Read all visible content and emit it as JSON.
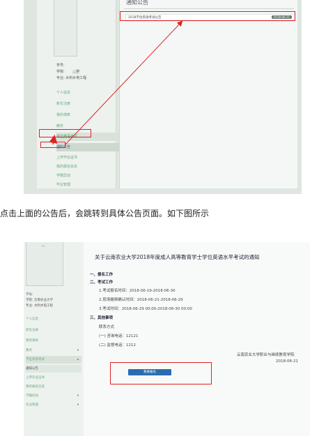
{
  "shot1": {
    "notice_title": "通知公告",
    "notice_item": {
      "title": "2018学位英语考试公告",
      "date": "2018-06-21"
    },
    "student_info": [
      {
        "label": "学号:",
        "value": ""
      },
      {
        "label": "学院:",
        "value": "…学"
      },
      {
        "label": "专业:",
        "value": "水利水电工程"
      }
    ],
    "menu": [
      {
        "label": "个人信息",
        "chev": ""
      },
      {
        "label": "新生注册",
        "chev": ""
      },
      {
        "label": "我的课表",
        "chev": ""
      },
      {
        "label": "教务",
        "chev": "▾"
      },
      {
        "label": "学位英语考试",
        "chev": "▴"
      },
      {
        "label": "通知公告",
        "chev": ""
      },
      {
        "label": "上传毕业证书",
        "chev": ""
      },
      {
        "label": "我的报名信息",
        "chev": ""
      },
      {
        "label": "学籍异动",
        "chev": "▾"
      },
      {
        "label": "毕业管理",
        "chev": "▾"
      }
    ]
  },
  "caption": "点击上面的公告后，会跳转到具体公告页面。如下图所示",
  "shot2": {
    "doc_title": "关于云南农业大学2018年度成人高等教育学士学位英语水平考试的通知",
    "sections": {
      "s1": "一、报名工作",
      "s2": "二、考试工作",
      "s2_1": "1.考试报名时间：2018-06-19-2018-06-30",
      "s2_2": "2.现场缴费确认时间：2018-06-21-2018-06-29",
      "s2_3": "3.考试时间：2018-06-29 00:00-2018-06-30 00:00",
      "s3": "三、其他事项",
      "contact": "联系方式",
      "c1": "(一) 咨询电话：12121",
      "c2": "(二) 监督电话：1212"
    },
    "signature": "云南农业大学职业与继续教育学院",
    "sign_date": "2018-06-21",
    "register_button": "我要报名",
    "student_info": [
      {
        "label": "学号:",
        "value": ""
      },
      {
        "label": "学院:",
        "value": "云南农业大学"
      },
      {
        "label": "专业:",
        "value": "水利水电工程"
      }
    ],
    "menu": [
      {
        "label": "个人信息",
        "chev": ""
      },
      {
        "label": "新生注册",
        "chev": ""
      },
      {
        "label": "我的课表",
        "chev": ""
      },
      {
        "label": "教务",
        "chev": "▾"
      },
      {
        "label": "学位英语考试",
        "chev": "▴"
      },
      {
        "label": "通知公告",
        "chev": ""
      },
      {
        "label": "上传毕业证书",
        "chev": ""
      },
      {
        "label": "我的报名信息",
        "chev": ""
      },
      {
        "label": "学籍异动",
        "chev": "▾"
      },
      {
        "label": "毕业管理",
        "chev": "▾"
      }
    ]
  },
  "colors": {
    "annotation_red": "#dd2222",
    "primary_button": "#2b6cb0"
  }
}
